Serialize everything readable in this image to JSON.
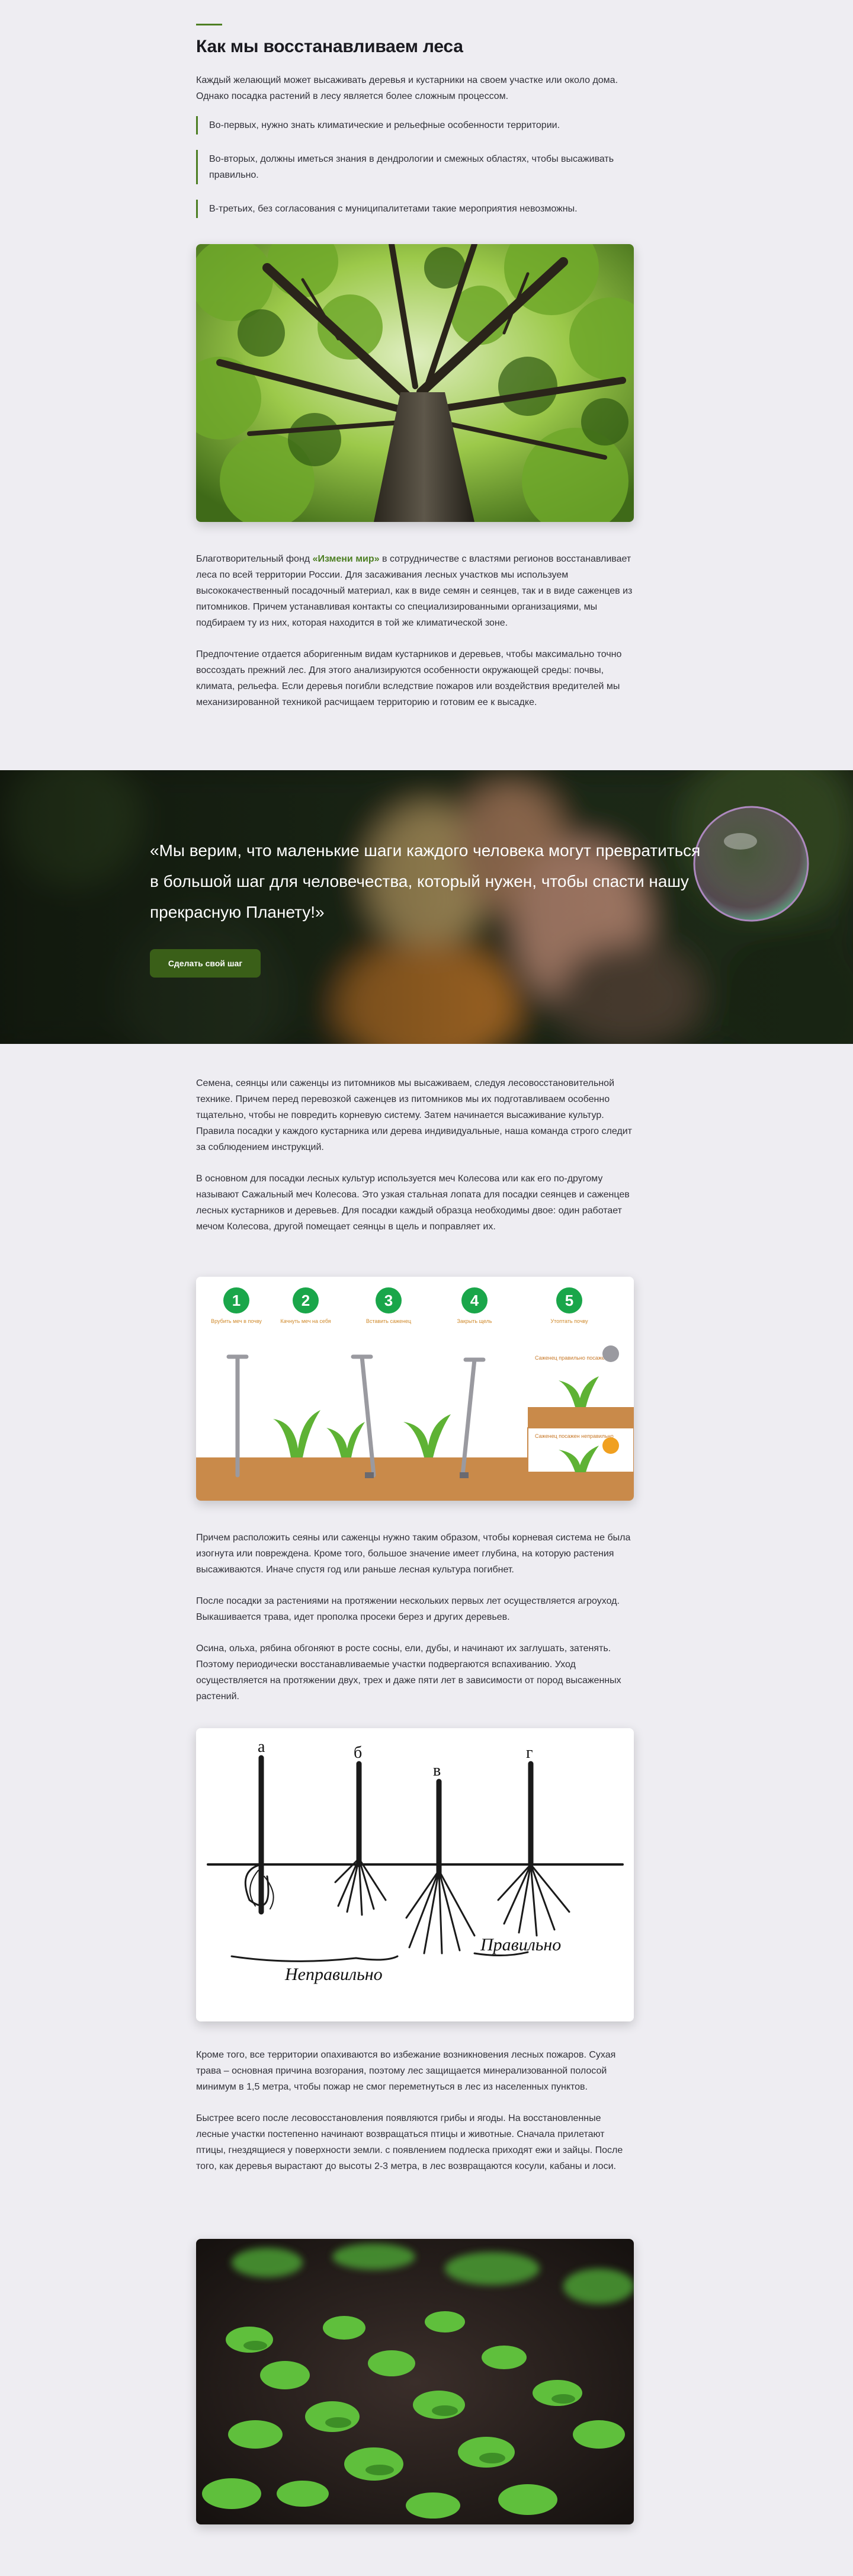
{
  "heading": "Как мы восстанавливаем леса",
  "intro": "Каждый желающий может высаживать деревья и кустарники на своем участке или около дома. Однако посадка растений в лесу является более сложным процессом.",
  "bullets": [
    "Во-первых, нужно знать климатические и рельефные особенности территории.",
    "Во-вторых, должны иметься знания в дендрологии и смежных областях, чтобы высаживать правильно.",
    "В-третьих, без согласования с муниципалитетами такие мероприятия невозможны."
  ],
  "para1": {
    "before": "Благотворительный фонд ",
    "link": "«Измени мир»",
    "after": " в сотрудничестве с властями регионов восстанавливает леса по всей территории России. Для засаживания  лесных участков мы используем высококачественный посадочный материал, как в виде семян и сеянцев, так и в виде саженцев из питомников. Причем устанавливая контакты со специализированными организациями, мы подбираем ту из них, которая находится в той же климатической зоне."
  },
  "para2": "Предпочтение отдается аборигенным видам кустарников и деревьев, чтобы максимально точно воссоздать прежний лес. Для этого анализируются особенности окружающей среды: почвы, климата, рельефа. Если деревья погибли вследствие пожаров или воздействия вредителей мы механизированной техникой расчищаем территорию и готовим ее к высадке.",
  "banner": {
    "quote": "«Мы верим, что маленькие шаги каждого человека могут превратиться в большой шаг для человечества, который нужен, чтобы спасти нашу прекрасную Планету!»",
    "button": "Сделать свой шаг"
  },
  "para3": "Семена, сеянцы или саженцы из питомников мы высаживаем, следуя лесовосстановительной технике. Причем перед перевозкой саженцев из питомников мы их подготавливаем особенно тщательно, чтобы не повредить корневую систему. Затем начинается высаживание культур. Правила посадки у каждого кустарника или дерева индивидуальные, наша команда строго следит за соблюдением инструкций.",
  "para4": "В основном для посадки лесных культур используется меч Колесова или как его по-другому называют Сажальный меч Колесова. Это узкая стальная лопата для посадки сеянцев и саженцев лесных кустарников и деревьев. Для посадки каждый образца необходимы двое: один работает мечом Колесова, другой помещает сеянцы в щель и поправляет их.",
  "steps": {
    "numbers": [
      "1",
      "2",
      "3",
      "4",
      "5"
    ],
    "captions": [
      "Врубить меч в почву",
      "Качнуть меч на себя",
      "Вставить саженец",
      "Закрыть щель",
      "Утоптать почву"
    ],
    "right_note": "Саженец правильно посажен",
    "wrong_note": "Саженец посажен неправильно"
  },
  "para5": "Причем расположить сеяны или саженцы нужно таким образом, чтобы корневая система не была изогнута или повреждена. Кроме того, большое значение имеет глубина, на которую растения высаживаются. Иначе спустя год или раньше лесная культура погибнет.",
  "para6": "После посадки за растениями на протяжении нескольких первых лет осуществляется агроуход. Выкашивается трава, идет прополка просеки берез и других деревьев.",
  "para7": "Осина, ольха, рябина обгоняют в росте сосны, ели, дубы, и начинают их заглушать, затенять. Поэтому периодически восстанавливаемые участки подвергаются вспахиванию. Уход осуществляется на протяжении двух, трех и даже пяти лет в зависимости от пород высаженных растений.",
  "roots": {
    "letters": [
      "а",
      "б",
      "в",
      "г"
    ],
    "wrong": "Неправильно",
    "right": "Правильно"
  },
  "para8": "Кроме того, все территории опахиваются во избежание возникновения лесных пожаров. Сухая трава – основная причина возгорания, поэтому лес защищается минерализованной полосой минимум в 1,5 метра, чтобы пожар не смог переметнуться в лес из населенных пунктов.",
  "para9": "Быстрее всего после лесовосстановления появляются грибы и ягоды. На восстановленные лесные участки постепенно начинают возвращаться птицы и животные. Сначала прилетают птицы, гнездящиеся у поверхности земли. с появлением подлеска приходят ежи и зайцы. После того, как деревья вырастают до высоты 2-3 метра, в лес возвращаются косули, кабаны и лоси.",
  "colors": {
    "accent": "#4d7f23",
    "button": "#3a5f18",
    "background": "#eeedf2"
  }
}
